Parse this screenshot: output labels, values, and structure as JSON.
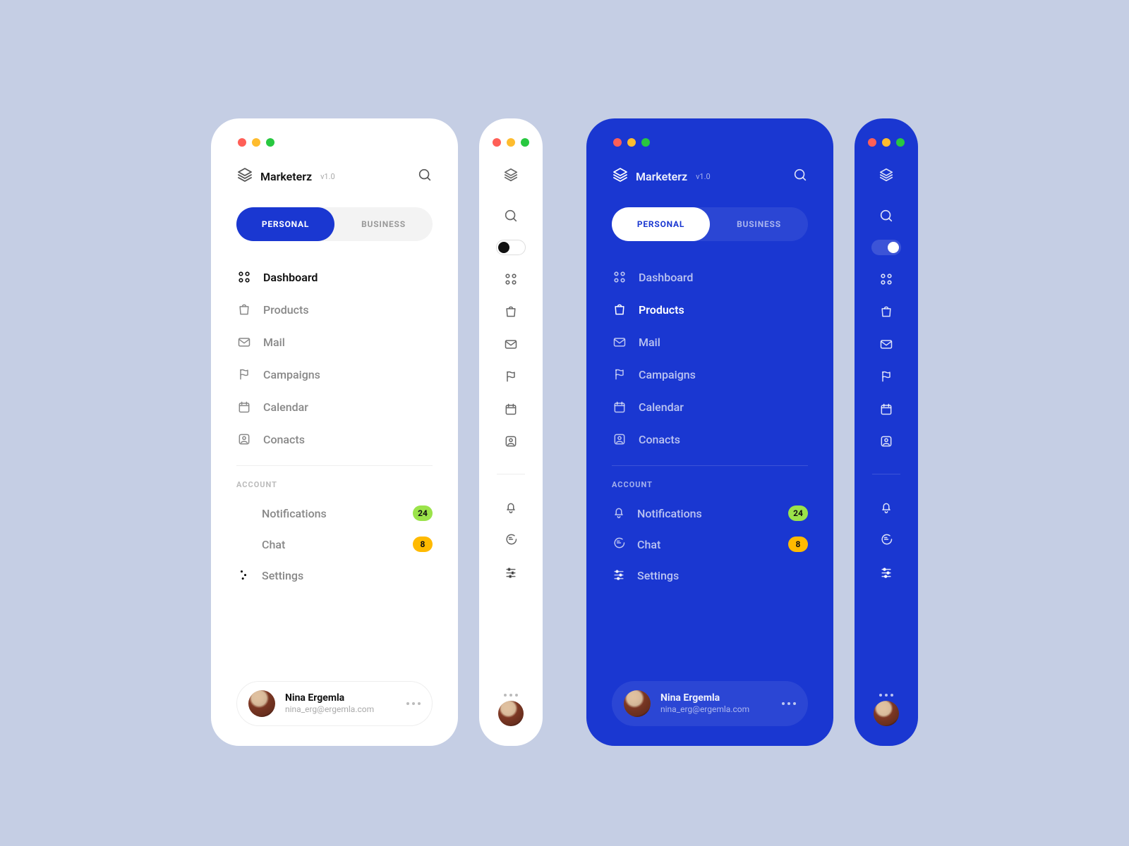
{
  "brand": {
    "name": "Marketerz",
    "version": "v1.0"
  },
  "tabs": {
    "personal": "PERSONAL",
    "business": "BUSINESS"
  },
  "nav": {
    "dashboard": "Dashboard",
    "products": "Products",
    "mail": "Mail",
    "campaigns": "Campaigns",
    "calendar": "Calendar",
    "contacts": "Conacts"
  },
  "account": {
    "section": "ACCOUNT",
    "notifications": "Notifications",
    "chat": "Chat",
    "settings": "Settings",
    "badges": {
      "notifications": "24",
      "chat": "8"
    }
  },
  "user": {
    "name": "Nina Ergemla",
    "email": "nina_erg@ergemla.com"
  },
  "colors": {
    "accent_blue": "#1A37D1",
    "badge_green": "#9BE34A",
    "badge_yellow": "#FFBA00"
  }
}
